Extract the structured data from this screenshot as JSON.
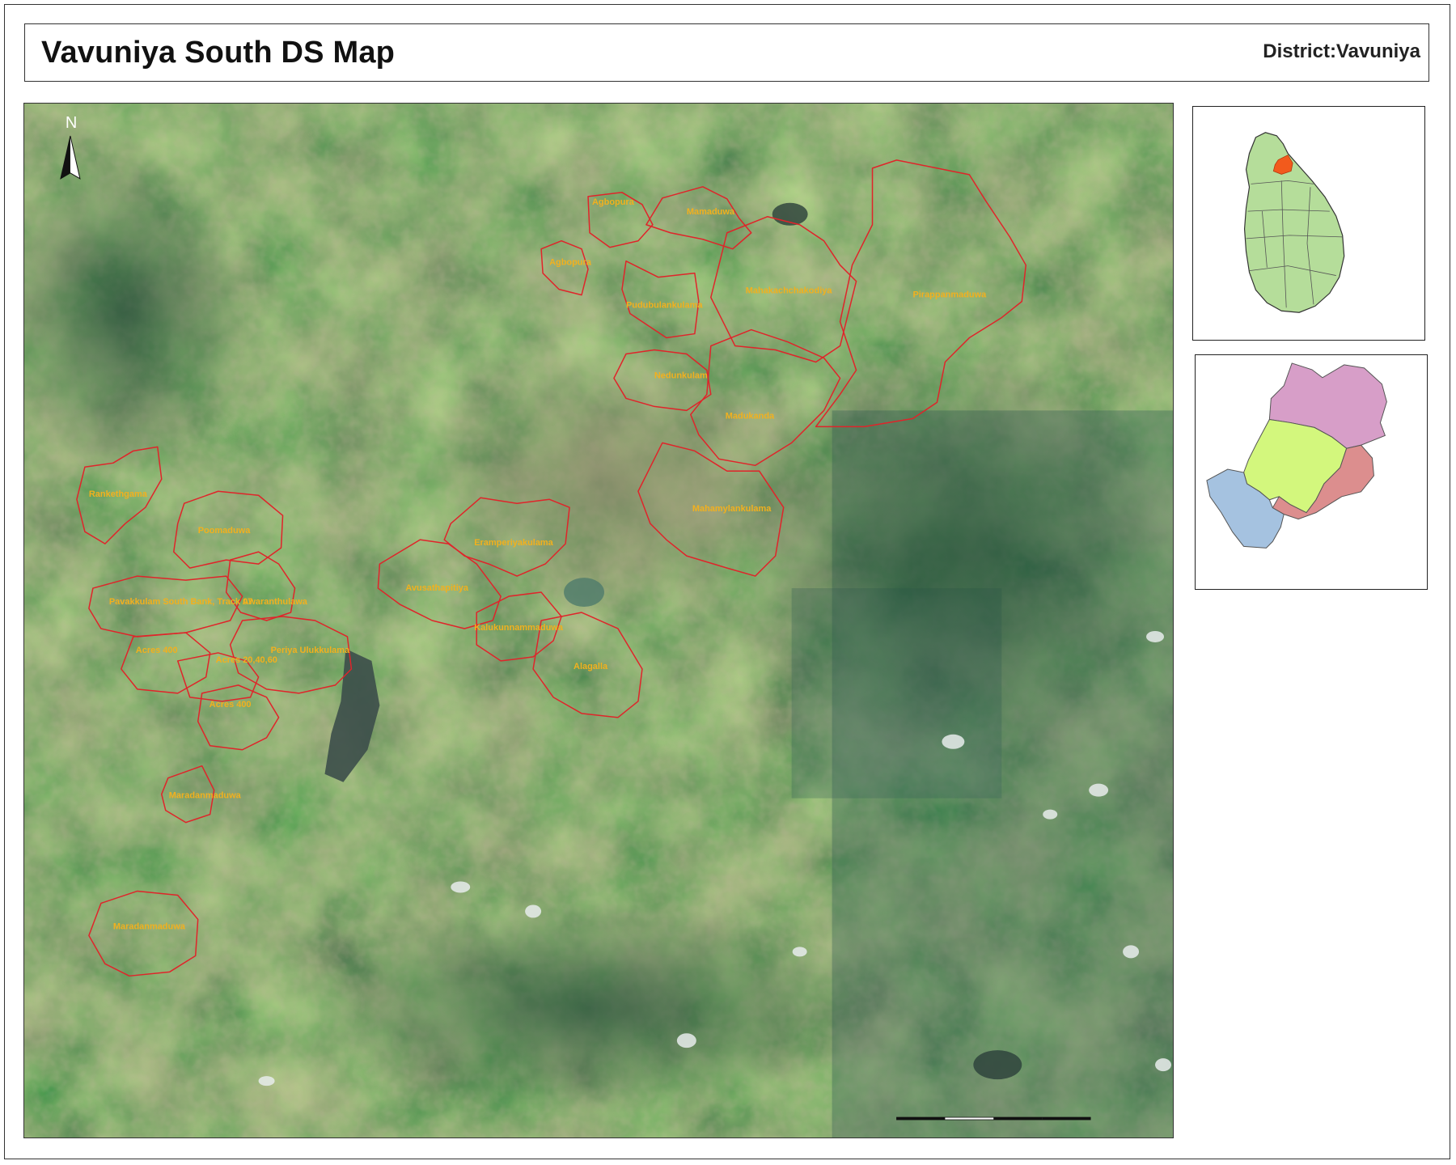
{
  "header": {
    "title": "Vavuniya South DS Map",
    "district": "District:Vavuniya"
  },
  "north_arrow": {
    "label": "N"
  },
  "gn_divisions": [
    "Agbopura",
    "Mamaduwa",
    "Agbopura",
    "Pudubulankulama",
    "Mahakachchakodiya",
    "Pirappanmaduwa",
    "Nedunkulam",
    "Madukanda",
    "Mahamylankulama",
    "Rankethgama",
    "Poomaduwa",
    "Eramperiyakulama",
    "Avusathapitiya",
    "Pavakkulam South Bank, Track 07",
    "Awaranthulawa",
    "Kalukunnammaduwa",
    "Acres 400",
    "Periya Ulukkulama",
    "Acres 20,40,60",
    "Alagalla",
    "Acres 400",
    "Maradanmaduwa",
    "Maradanmaduwa"
  ],
  "colors": {
    "boundary": "#e0242a",
    "label": "#f2b01e",
    "sri_lanka_fill": "#b5dd9a",
    "highlight": "#f25a1c",
    "ds_pink": "#d79ec8",
    "ds_lime": "#d3f77d",
    "ds_rose": "#dc8e8e",
    "ds_blue": "#a5c2e0"
  },
  "icons": [
    "north-arrow-icon",
    "scale-bar-icon"
  ]
}
